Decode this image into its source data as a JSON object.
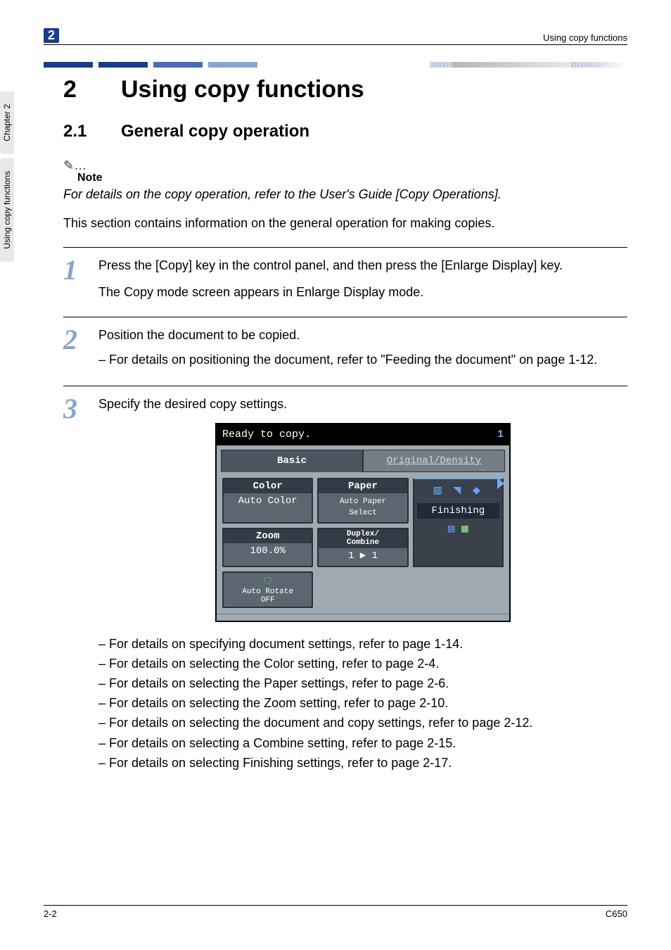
{
  "header": {
    "chapter_num_chip": "2",
    "running_title": "Using copy functions"
  },
  "side": {
    "tab_chapter": "Chapter 2",
    "tab_section": "Using copy functions"
  },
  "title": {
    "num": "2",
    "text": "Using copy functions"
  },
  "subtitle": {
    "num": "2.1",
    "text": "General copy operation"
  },
  "note": {
    "icon": "✎…",
    "label": "Note",
    "body": "For details on the copy operation, refer to the User's Guide [Copy Operations]."
  },
  "intro": "This section contains information on the general operation for making copies.",
  "steps": [
    {
      "num": "1",
      "main": "Press the [Copy] key in the control panel, and then press the [Enlarge Display] key.",
      "sub": "The Copy mode screen appears in Enlarge Display mode."
    },
    {
      "num": "2",
      "main": "Position the document to be copied.",
      "bullets": [
        "For details on positioning the document, refer to \"Feeding the document\" on page 1-12."
      ]
    },
    {
      "num": "3",
      "main": "Specify the desired copy settings.",
      "has_screen": true,
      "bullets": [
        "For details on specifying document settings, refer to page 1-14.",
        "For details on selecting the Color setting, refer to page 2-4.",
        "For details on selecting the Paper settings, refer to page 2-6.",
        "For details on selecting the Zoom setting, refer to page 2-10.",
        "For details on selecting the document and copy settings, refer to page 2-12.",
        "For details on selecting a Combine setting, refer to page 2-15.",
        "For details on selecting Finishing settings, refer to page 2-17."
      ]
    }
  ],
  "screen": {
    "status": "Ready to copy.",
    "count": "1",
    "tab_basic": "Basic",
    "tab_original": "Original/Density",
    "color_label": "Color",
    "color_value": "Auto Color",
    "paper_label": "Paper",
    "paper_value_l1": "Auto Paper",
    "paper_value_l2": "Select",
    "zoom_label": "Zoom",
    "zoom_value": "100.0%",
    "duplex_label_l1": "Duplex/",
    "duplex_label_l2": "Combine",
    "duplex_value": "1 ▶ 1",
    "finishing_label": "Finishing",
    "auto_rotate_l1": "Auto Rotate",
    "auto_rotate_l2": "OFF"
  },
  "footer": {
    "page": "2-2",
    "model": "C650"
  }
}
